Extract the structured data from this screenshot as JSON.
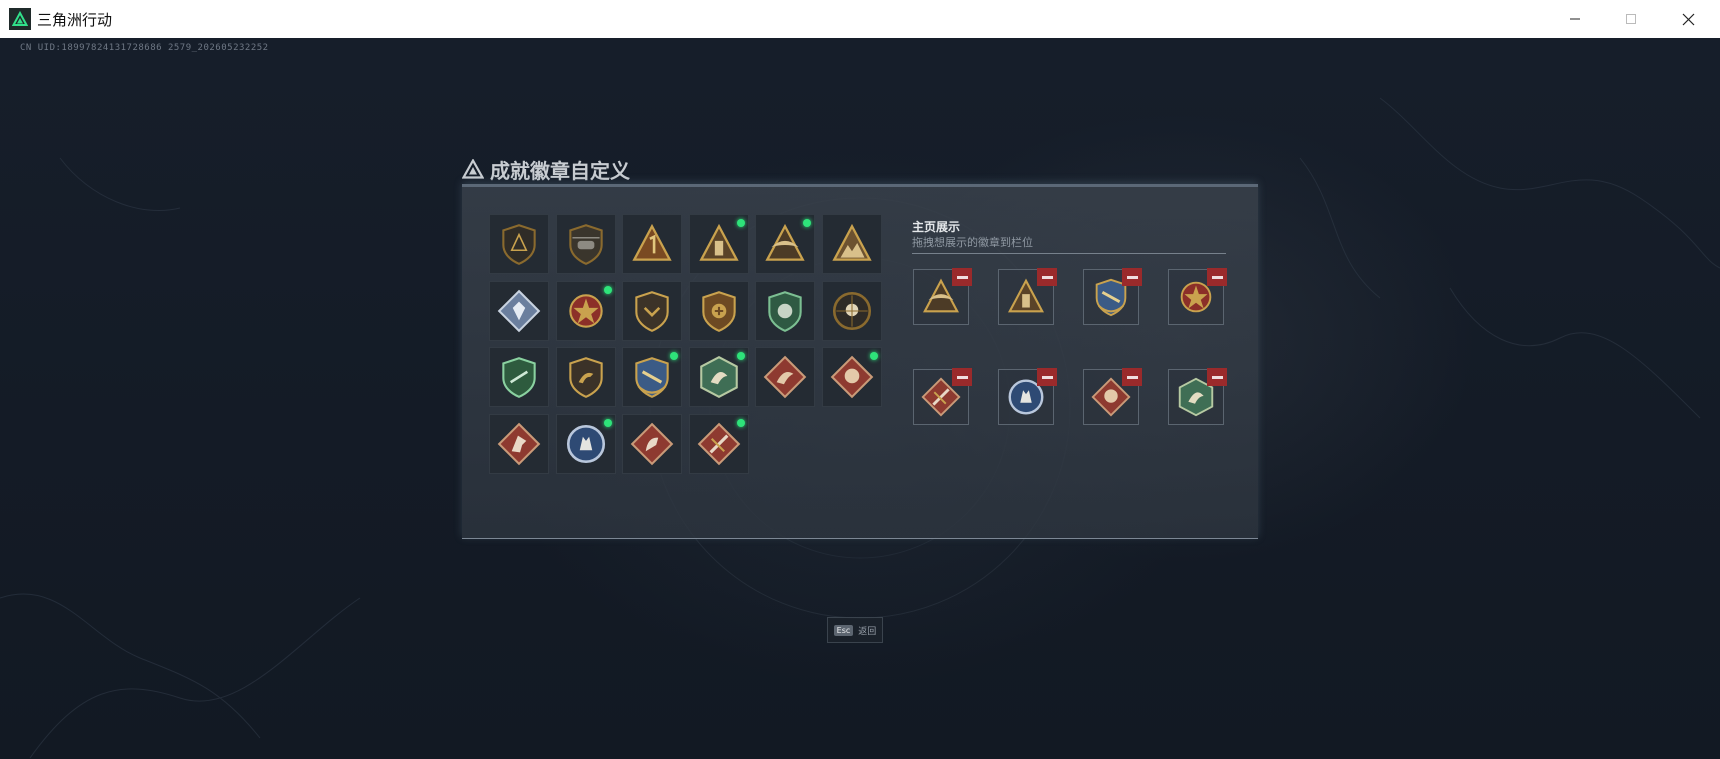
{
  "window": {
    "title": "三角洲行动"
  },
  "game": {
    "uid": "CN UID:18997824131728686 2579_202605232252"
  },
  "panel": {
    "title": "成就徽章自定义",
    "badges": [
      {
        "icon": "triangle-shield-badge-icon",
        "new": false
      },
      {
        "icon": "helicopter-badge-icon",
        "new": false
      },
      {
        "icon": "number-one-triangle-badge-icon",
        "new": false
      },
      {
        "icon": "bottle-triangle-badge-icon",
        "new": true
      },
      {
        "icon": "winged-triangle-badge-icon",
        "new": true
      },
      {
        "icon": "mountain-triangle-badge-icon",
        "new": false
      },
      {
        "icon": "crystal-diamond-badge-icon",
        "new": false
      },
      {
        "icon": "star-medal-badge-icon",
        "new": true
      },
      {
        "icon": "chevron-shield-badge-icon",
        "new": false
      },
      {
        "icon": "medical-shield-badge-icon",
        "new": false
      },
      {
        "icon": "green-lion-shield-badge-icon",
        "new": false
      },
      {
        "icon": "skull-crosshair-badge-icon",
        "new": false
      },
      {
        "icon": "green-wreath-shield-badge-icon",
        "new": false
      },
      {
        "icon": "dinosaur-shield-badge-icon",
        "new": false
      },
      {
        "icon": "blue-shield-wreath-badge-icon",
        "new": true
      },
      {
        "icon": "green-hexagon-dragon-badge-icon",
        "new": true
      },
      {
        "icon": "red-diamond-dragon-badge-icon",
        "new": false
      },
      {
        "icon": "red-diamond-beast-badge-icon",
        "new": true
      },
      {
        "icon": "red-diamond-horse-badge-icon",
        "new": false
      },
      {
        "icon": "blue-circle-wolf-badge-icon",
        "new": true
      },
      {
        "icon": "red-diamond-stallion-badge-icon",
        "new": false
      },
      {
        "icon": "red-diamond-weapon-badge-icon",
        "new": true
      }
    ],
    "showcase": {
      "title": "主页展示",
      "subtitle": "拖拽想展示的徽章到栏位",
      "slots": [
        {
          "icon": "winged-triangle-badge-icon"
        },
        {
          "icon": "bottle-triangle-badge-icon"
        },
        {
          "icon": "blue-shield-wreath-badge-icon"
        },
        {
          "icon": "star-medal-badge-icon"
        },
        {
          "icon": "red-diamond-weapon-badge-icon"
        },
        {
          "icon": "blue-circle-wolf-badge-icon"
        },
        {
          "icon": "red-diamond-beast-badge-icon"
        },
        {
          "icon": "green-hexagon-dragon-badge-icon"
        }
      ]
    }
  },
  "footer": {
    "esc_key": "Esc",
    "esc_label": "返回"
  },
  "colors": {
    "new_dot": "#2ee37a",
    "remove_button": "#9a2a2b",
    "gold": "#c9a24e",
    "background": "#151c27"
  }
}
